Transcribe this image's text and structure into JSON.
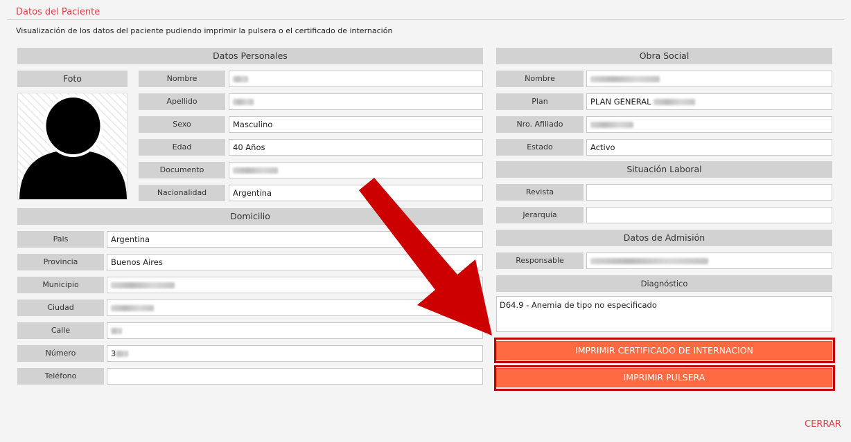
{
  "header": {
    "title": "Datos del Paciente",
    "subtitle": "Visualización de los datos del paciente pudiendo imprimir la pulsera o el certificado de internación"
  },
  "personal": {
    "section_title": "Datos Personales",
    "photo_label": "Foto",
    "fields": [
      {
        "label": "Nombre",
        "value": ""
      },
      {
        "label": "Apellido",
        "value": ""
      },
      {
        "label": "Sexo",
        "value": "Masculino"
      },
      {
        "label": "Edad",
        "value": "40 Años"
      },
      {
        "label": "Documento",
        "value": ""
      },
      {
        "label": "Nacionalidad",
        "value": "Argentina"
      }
    ]
  },
  "domicilio": {
    "section_title": "Domicilio",
    "fields": [
      {
        "label": "Pais",
        "value": "Argentina"
      },
      {
        "label": "Provincia",
        "value": "Buenos Aires"
      },
      {
        "label": "Municipio",
        "value": ""
      },
      {
        "label": "Ciudad",
        "value": ""
      },
      {
        "label": "Calle",
        "value": ""
      },
      {
        "label": "Número",
        "value": "3"
      },
      {
        "label": "Teléfono",
        "value": ""
      }
    ]
  },
  "obra_social": {
    "section_title": "Obra Social",
    "fields": [
      {
        "label": "Nombre",
        "value": ""
      },
      {
        "label": "Plan",
        "value": "PLAN GENERAL"
      },
      {
        "label": "Nro. Afiliado",
        "value": ""
      },
      {
        "label": "Estado",
        "value": "Activo"
      }
    ]
  },
  "situacion_laboral": {
    "section_title": "Situación Laboral",
    "fields": [
      {
        "label": "Revista",
        "value": ""
      },
      {
        "label": "Jerarquía",
        "value": ""
      }
    ]
  },
  "admision": {
    "section_title": "Datos de Admisión",
    "fields": [
      {
        "label": "Responsable",
        "value": ""
      }
    ],
    "diagnostico_title": "Diagnóstico",
    "diagnostico_value": "D64.9 - Anemia de tipo no especificado"
  },
  "actions": {
    "print_certificate": "IMPRIMIR CERTIFICADO DE INTERNACION",
    "print_wristband": "IMPRIMIR PULSERA",
    "close": "CERRAR"
  },
  "colors": {
    "accent_red": "#e04040",
    "button_orange": "#ff6a42",
    "highlight_red": "#c00000"
  },
  "icons": {
    "photo": "person-silhouette-icon",
    "annotation": "red-arrow-icon"
  }
}
